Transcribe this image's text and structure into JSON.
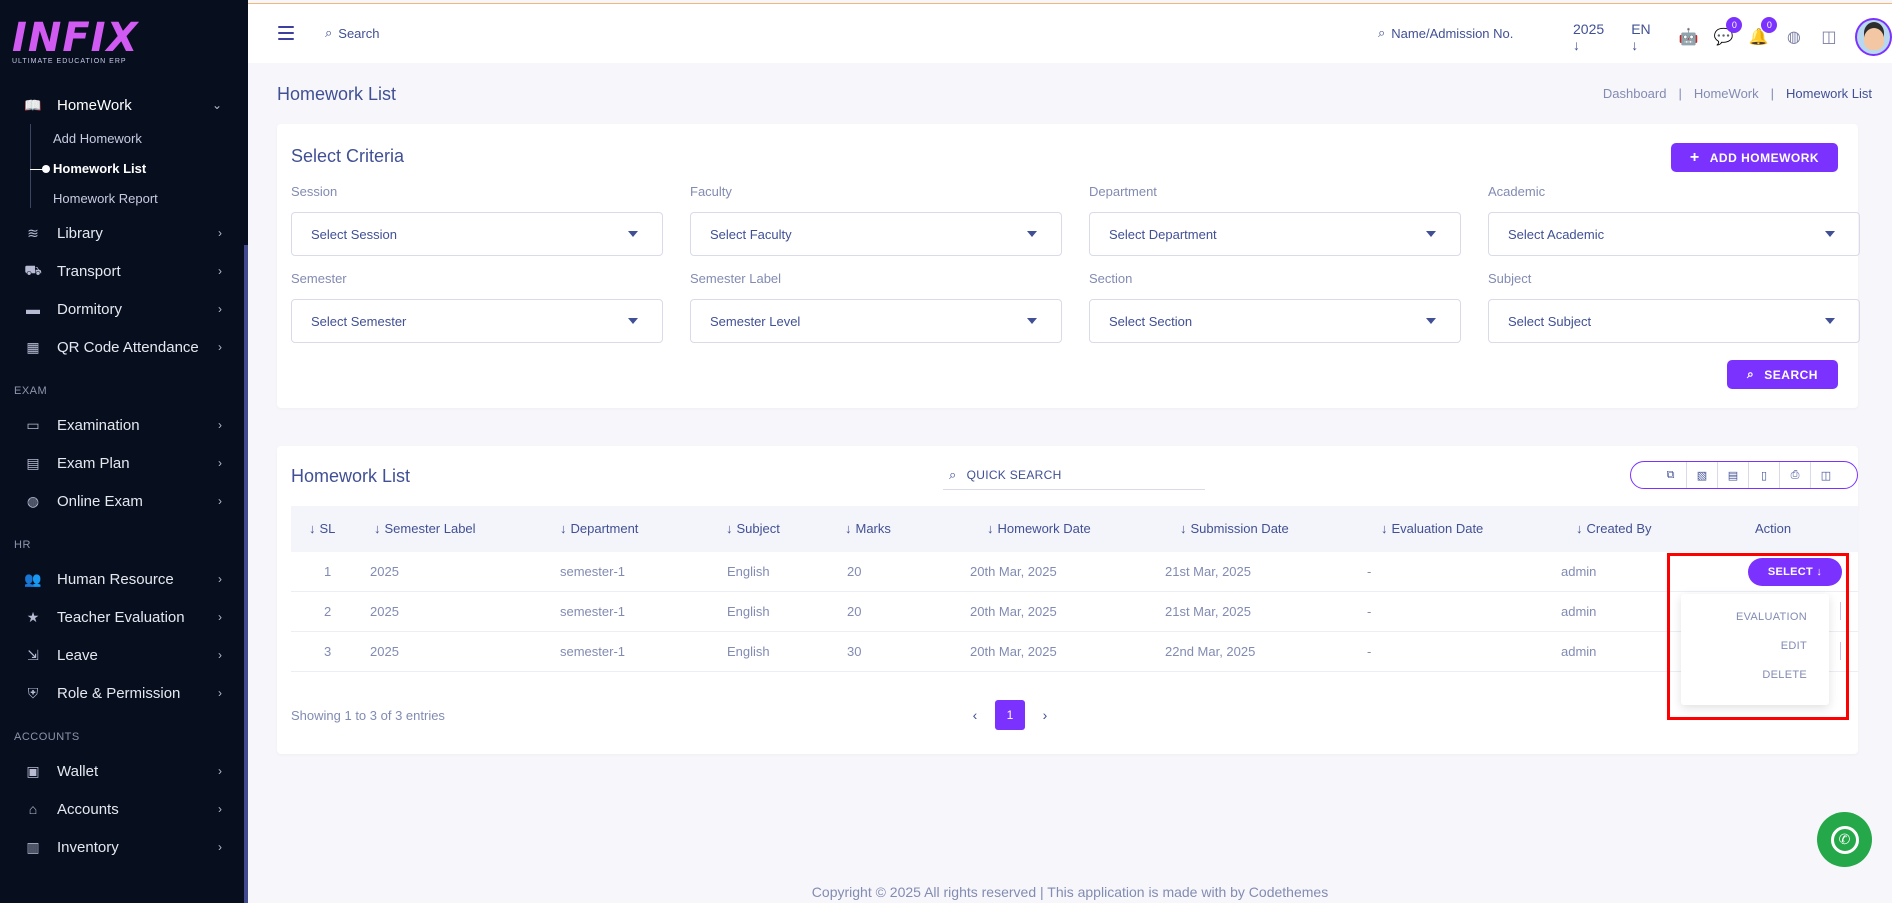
{
  "logo": {
    "word": "INFIX",
    "tagline": "ULTIMATE EDUCATION ERP"
  },
  "sidebar": {
    "homework": {
      "label": "HomeWork",
      "sub": [
        "Add Homework",
        "Homework List",
        "Homework Report"
      ]
    },
    "items1": [
      "Library",
      "Transport",
      "Dormitory",
      "QR Code Attendance"
    ],
    "exam_title": "EXAM",
    "items2": [
      "Examination",
      "Exam Plan",
      "Online Exam"
    ],
    "hr_title": "HR",
    "items3": [
      "Human Resource",
      "Teacher Evaluation",
      "Leave",
      "Role & Permission"
    ],
    "accounts_title": "ACCOUNTS",
    "items4": [
      "Wallet",
      "Accounts",
      "Inventory"
    ]
  },
  "topbar": {
    "search": "Search",
    "name_search": "Name/Admission No.",
    "year": "2025",
    "lang": "EN",
    "chat_badge": "0",
    "notif_badge": "0"
  },
  "page": {
    "title": "Homework List",
    "breadcrumb": [
      "Dashboard",
      "HomeWork",
      "Homework List"
    ]
  },
  "criteria": {
    "title": "Select Criteria",
    "add_button": "ADD HOMEWORK",
    "search_button": "SEARCH",
    "fields": [
      {
        "label": "Session",
        "value": "Select Session"
      },
      {
        "label": "Faculty",
        "value": "Select Faculty"
      },
      {
        "label": "Department",
        "value": "Select Department"
      },
      {
        "label": "Academic",
        "value": "Select Academic"
      },
      {
        "label": "Semester",
        "value": "Select Semester"
      },
      {
        "label": "Semester Label",
        "value": "Semester Level"
      },
      {
        "label": "Section",
        "value": "Select Section"
      },
      {
        "label": "Subject",
        "value": "Select Subject"
      }
    ]
  },
  "list": {
    "title": "Homework List",
    "quick_search": "QUICK SEARCH",
    "columns": [
      "SL",
      "Semester Label",
      "Department",
      "Subject",
      "Marks",
      "Homework Date",
      "Submission Date",
      "Evaluation Date",
      "Created By",
      "Action"
    ],
    "rows": [
      [
        "1",
        "2025",
        "semester-1",
        "English",
        "20",
        "20th Mar, 2025",
        "21st Mar, 2025",
        "-",
        "admin"
      ],
      [
        "2",
        "2025",
        "semester-1",
        "English",
        "20",
        "20th Mar, 2025",
        "21st Mar, 2025",
        "-",
        "admin"
      ],
      [
        "3",
        "2025",
        "semester-1",
        "English",
        "30",
        "20th Mar, 2025",
        "22nd Mar, 2025",
        "-",
        "admin"
      ]
    ],
    "action_button": "SELECT",
    "dropdown": [
      "EVALUATION",
      "EDIT",
      "DELETE"
    ],
    "showing": "Showing 1 to 3 of 3 entries",
    "page": "1"
  },
  "footer": "Copyright © 2025 All rights reserved | This application is made with by Codethemes",
  "colors": {
    "primary": "#7c32ff",
    "sidebar": "#070f1f",
    "text": "#415094",
    "highlight": "#ff0000"
  }
}
